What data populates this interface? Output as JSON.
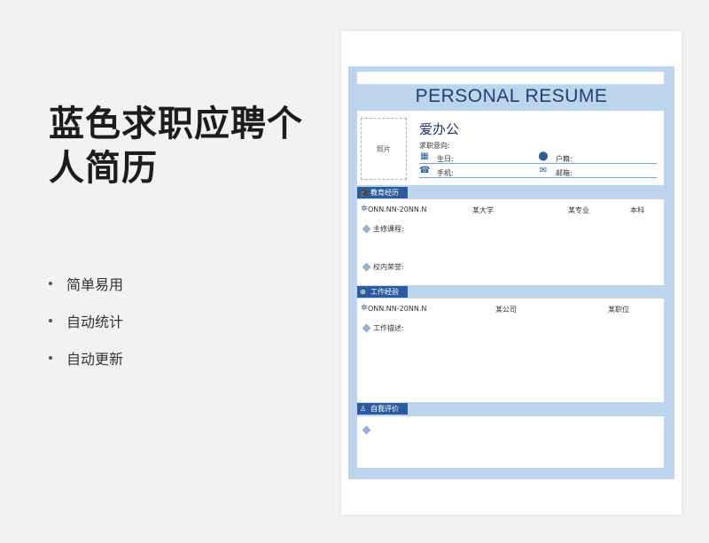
{
  "promo": {
    "title_line1": "蓝色求职应聘个",
    "title_line2": "人简历",
    "features": [
      "简单易用",
      "自动统计",
      "自动更新"
    ]
  },
  "resume": {
    "title": "PERSONAL RESUME",
    "photo_label": "照片",
    "name": "爱办公",
    "intent_label": "求职意向:",
    "birthday_label": "生日:",
    "hometown_label": "户籍:",
    "phone_label": "手机:",
    "email_label": "邮箱:",
    "education": {
      "tab": "教育经历",
      "date": "ONN.NN-20NN.N",
      "school": "某大学",
      "major": "某专业",
      "degree": "本科",
      "courses_label": "主修课程:",
      "honors_label": "校内荣誉:"
    },
    "work": {
      "tab": "工作经验",
      "date": "ONN.NN-20NN.N",
      "company": "某公司",
      "position": "某职位",
      "desc_label": "工作描述:"
    },
    "self_eval": {
      "tab": "自我评价"
    }
  },
  "colors": {
    "frame": "#bcd4ec",
    "tab": "#2b5a9e",
    "title": "#1f3f75"
  },
  "icons": [
    "calendar-icon",
    "location-icon",
    "phone-icon",
    "mail-icon",
    "graduation-cap-icon",
    "gear-icon",
    "globe-icon",
    "person-icon",
    "diamond-bullet-icon"
  ]
}
